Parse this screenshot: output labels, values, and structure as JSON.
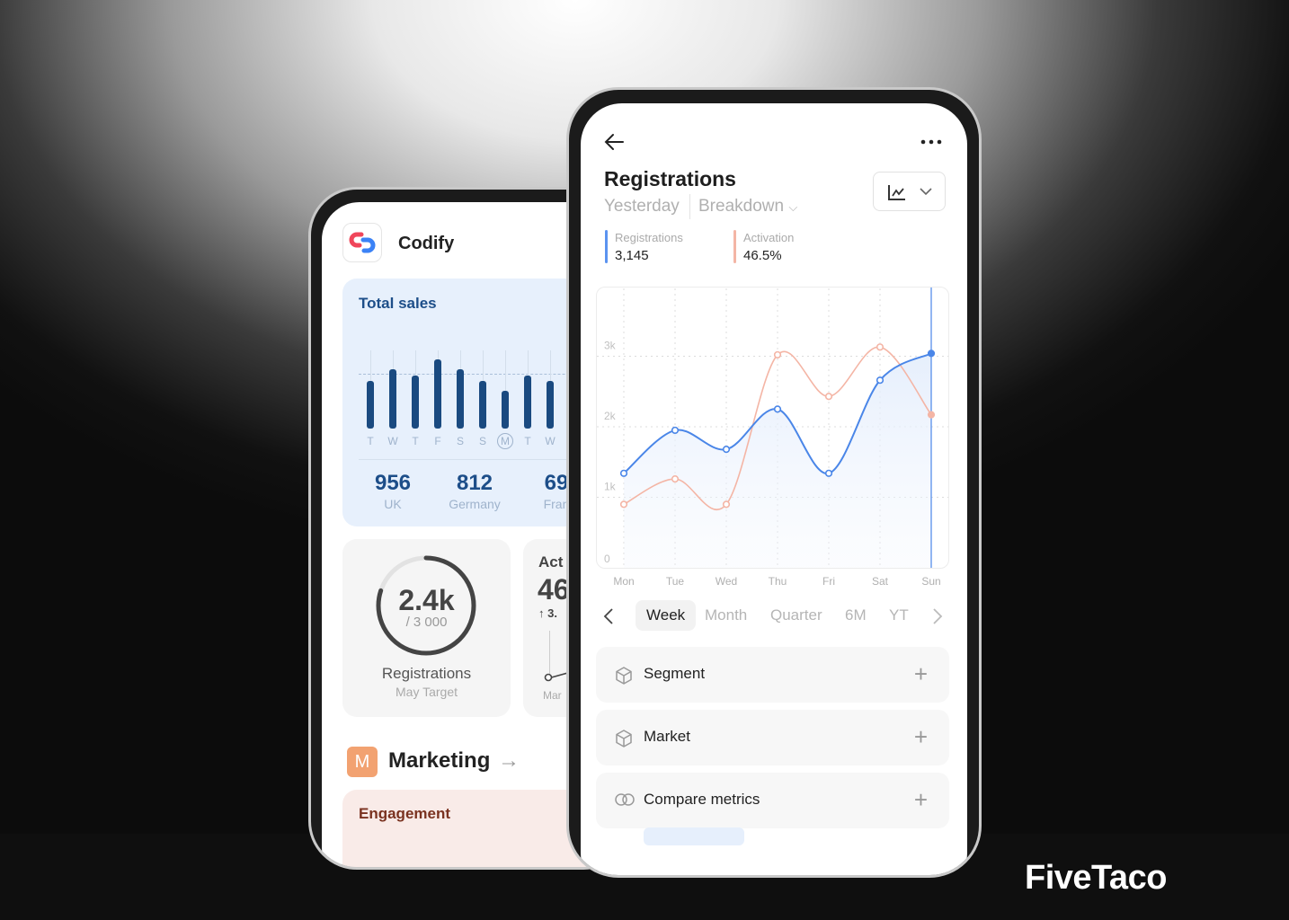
{
  "brand": {
    "logo_text": "FiveTaco"
  },
  "left_phone": {
    "app": {
      "name": "Codify",
      "logo_colors": [
        "#f0465a",
        "#3b82f6"
      ]
    },
    "total_sales": {
      "title": "Total sales",
      "bars": [
        {
          "day": "T",
          "value": 53
        },
        {
          "day": "W",
          "value": 66
        },
        {
          "day": "T",
          "value": 59
        },
        {
          "day": "F",
          "value": 77
        },
        {
          "day": "S",
          "value": 66
        },
        {
          "day": "S",
          "value": 53
        },
        {
          "day": "M",
          "value": 42,
          "selected": true
        },
        {
          "day": "T",
          "value": 59
        },
        {
          "day": "W",
          "value": 53
        }
      ],
      "stats": [
        {
          "value": "956",
          "label": "UK"
        },
        {
          "value": "812",
          "label": "Germany"
        },
        {
          "value": "69",
          "label": "Fran"
        }
      ],
      "bar_color": "#1a4a80"
    },
    "registrations_card": {
      "value": "2.4k",
      "target": "/ 3 000",
      "title": "Registrations",
      "subtitle": "May Target",
      "progress": 0.8
    },
    "activation_card": {
      "title": "Act",
      "value": "46",
      "change": "↑ 3.",
      "axis_label": "Mar"
    },
    "marketing": {
      "badge": "M",
      "title": "Marketing",
      "badge_color": "#f2a271"
    },
    "engagement": {
      "title": "Engagement"
    }
  },
  "right_phone": {
    "header": {
      "back_icon": "arrow-left-icon",
      "more_icon": "more-horizontal-icon"
    },
    "title": "Registrations",
    "subtitle": {
      "period": "Yesterday",
      "breakdown": "Breakdown"
    },
    "metrics": [
      {
        "label": "Registrations",
        "value": "3,145",
        "color": "#5b93f0"
      },
      {
        "label": "Activation",
        "value": "46.5%",
        "color": "#f4b5a5"
      }
    ],
    "chart_type_button": {
      "icon": "line-chart-icon"
    },
    "chart_data": {
      "type": "line",
      "categories": [
        "Mon",
        "Tue",
        "Wed",
        "Thu",
        "Fri",
        "Sat",
        "Sun"
      ],
      "y_ticks": [
        "0",
        "1k",
        "2k",
        "3k"
      ],
      "ylim": [
        0,
        3000
      ],
      "grid": true,
      "series": [
        {
          "name": "Registrations",
          "color": "#4a86e8",
          "values": [
            1340,
            1950,
            1680,
            2250,
            1340,
            2660,
            3040
          ]
        },
        {
          "name": "Activation",
          "color": "#f4b5a5",
          "values": [
            900,
            1260,
            900,
            3020,
            2430,
            3130,
            2170
          ]
        }
      ],
      "highlight": "Sun"
    },
    "periods": {
      "items": [
        "Week",
        "Month",
        "Quarter",
        "6M",
        "YT"
      ],
      "selected": "Week"
    },
    "rows": [
      {
        "label": "Segment",
        "icon": "cube-icon"
      },
      {
        "label": "Market",
        "icon": "cube-icon"
      },
      {
        "label": "Compare metrics",
        "icon": "compare-circles-icon"
      }
    ]
  }
}
